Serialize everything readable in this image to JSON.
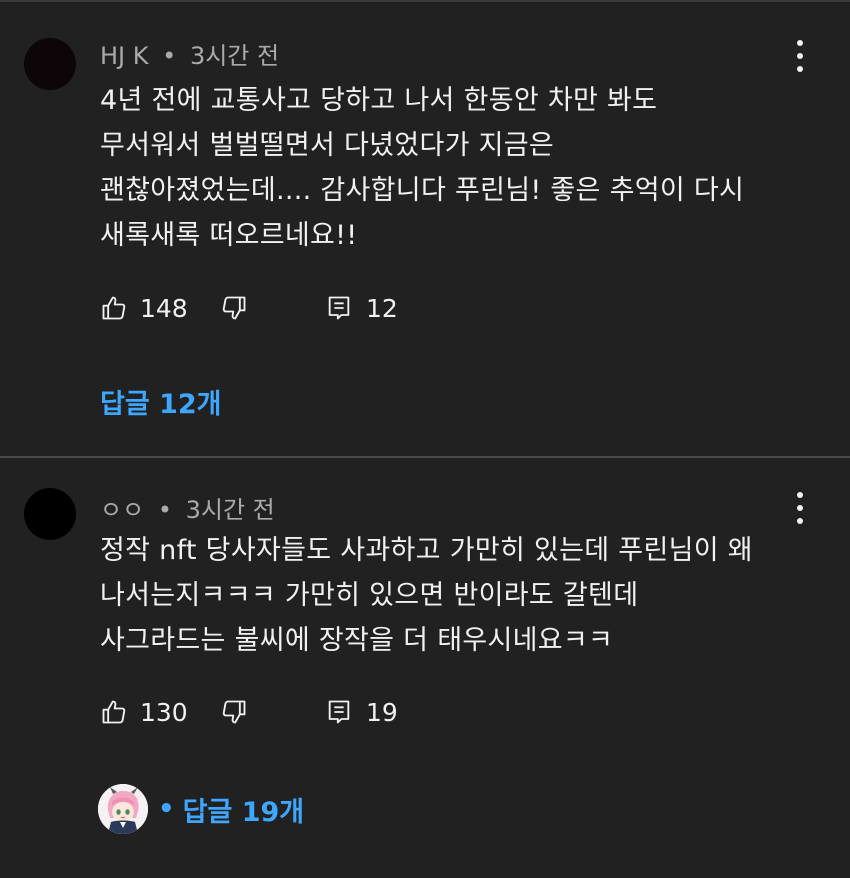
{
  "comments": [
    {
      "author": "HJ K",
      "time": "3시간 전",
      "lines": [
        "4년 전에 교통사고 당하고 나서 한동안 차만 봐도",
        "무서워서 벌벌떨면서 다녔었다가 지금은",
        "괜찮아졌었는데.... 감사합니다 푸린님!  좋은 추억이 다시",
        "새록새록 떠오르네요!!"
      ],
      "likes": "148",
      "reply_count": "12",
      "replies_label": "답글 12개"
    },
    {
      "author": "ㅇㅇ",
      "time": "3시간 전",
      "lines": [
        "정작 nft 당사자들도 사과하고 가만히 있는데 푸린님이 왜",
        "나서는지ㅋㅋㅋ 가만히 있으면 반이라도 갈텐데",
        "사그라드는 불씨에 장작을 더 태우시네요ㅋㅋ"
      ],
      "likes": "130",
      "reply_count": "19",
      "replies_label": "답글 19개"
    }
  ],
  "separator": "•",
  "icons": {
    "like": "thumb-up-icon",
    "dislike": "thumb-down-icon",
    "reply": "comment-icon",
    "more": "more-vert-icon"
  },
  "colors": {
    "background": "#212121",
    "link": "#3ea6ff",
    "meta": "#aaaaaa",
    "text": "#f1f1f1"
  }
}
